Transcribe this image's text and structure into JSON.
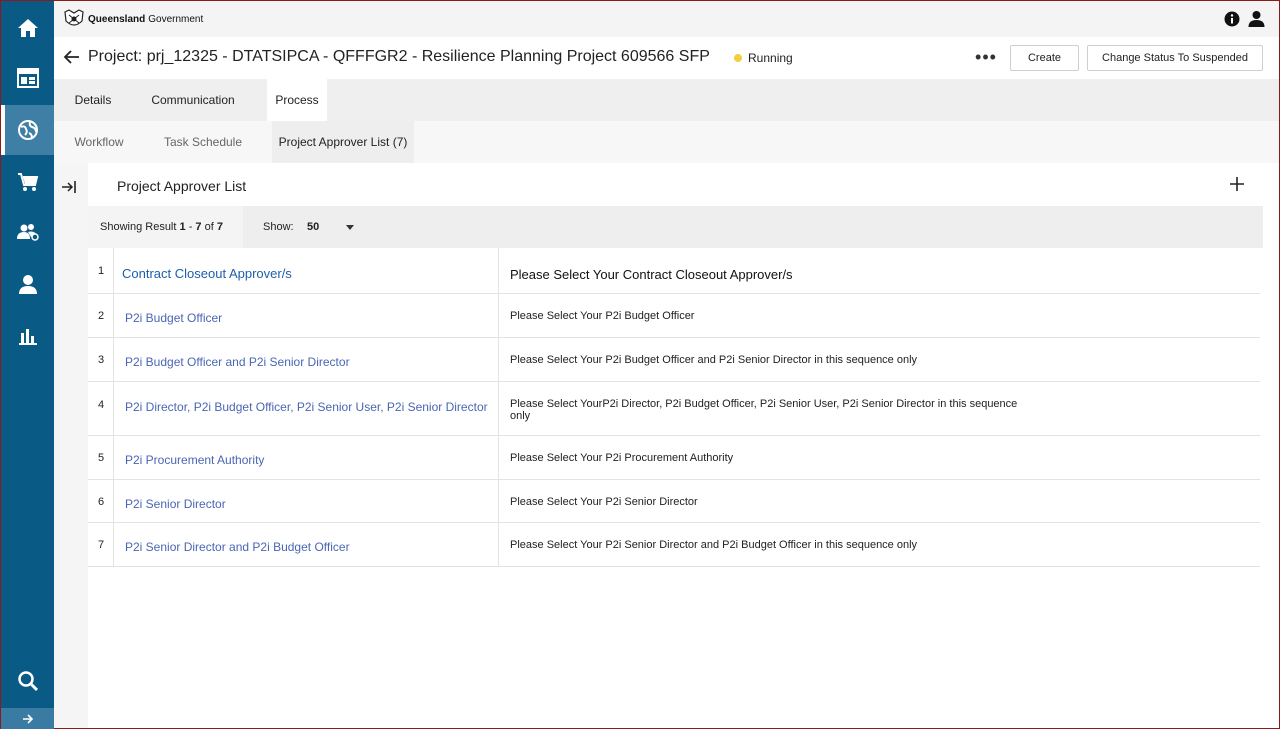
{
  "gov": {
    "brand_bold": "Queensland",
    "brand": "Government"
  },
  "project": {
    "title": "Project: prj_12325 - DTATSIPCA - QFFFGR2 - Resilience Planning Project 609566 SFP",
    "status": "Running",
    "more": "•••",
    "create_label": "Create",
    "suspend_label": "Change Status To Suspended"
  },
  "tabs": [
    {
      "label": "Details"
    },
    {
      "label": "Communication"
    },
    {
      "label": "Process"
    }
  ],
  "subtabs": [
    {
      "label": "Workflow"
    },
    {
      "label": "Task Schedule"
    },
    {
      "label": "Project Approver List (7)"
    }
  ],
  "panel": {
    "title": "Project Approver List",
    "showing_prefix": "Showing Result",
    "showing_from": "1",
    "showing_dash": "-",
    "showing_to": "7",
    "showing_of": "of",
    "showing_total": "7",
    "show_label": "Show:",
    "show_value": "50"
  },
  "rows": [
    {
      "num": "1",
      "name": "Contract Closeout Approver/s",
      "desc": "Please Select Your Contract Closeout Approver/s"
    },
    {
      "num": "2",
      "name": "P2i Budget Officer",
      "desc": "Please Select Your P2i Budget Officer"
    },
    {
      "num": "3",
      "name": "P2i Budget Officer and P2i Senior Director",
      "desc": "Please Select Your P2i Budget Officer and P2i Senior Director in this sequence only"
    },
    {
      "num": "4",
      "name": "P2i Director, P2i Budget Officer, P2i Senior User, P2i Senior Director",
      "desc": "Please Select YourP2i Director, P2i Budget Officer, P2i Senior User, P2i Senior Director in this sequence only"
    },
    {
      "num": "5",
      "name": "P2i Procurement Authority",
      "desc": "Please Select Your P2i Procurement Authority"
    },
    {
      "num": "6",
      "name": "P2i Senior Director",
      "desc": "Please Select Your P2i Senior Director"
    },
    {
      "num": "7",
      "name": "P2i Senior Director and P2i Budget Officer",
      "desc": "Please Select Your P2i Senior Director and P2i Budget Officer in this sequence only"
    }
  ],
  "sidebar": {
    "icons": [
      "home-icon",
      "dashboard-icon",
      "globe-icon",
      "cart-icon",
      "team-icon",
      "user-icon",
      "chart-icon",
      "search-icon",
      "arrow-right-icon"
    ]
  },
  "colors": {
    "sidebar": "#0a5a86",
    "sidebar_active": "#3f7fa6",
    "link": "#4a66b4",
    "status_running": "#f2cf3b"
  }
}
